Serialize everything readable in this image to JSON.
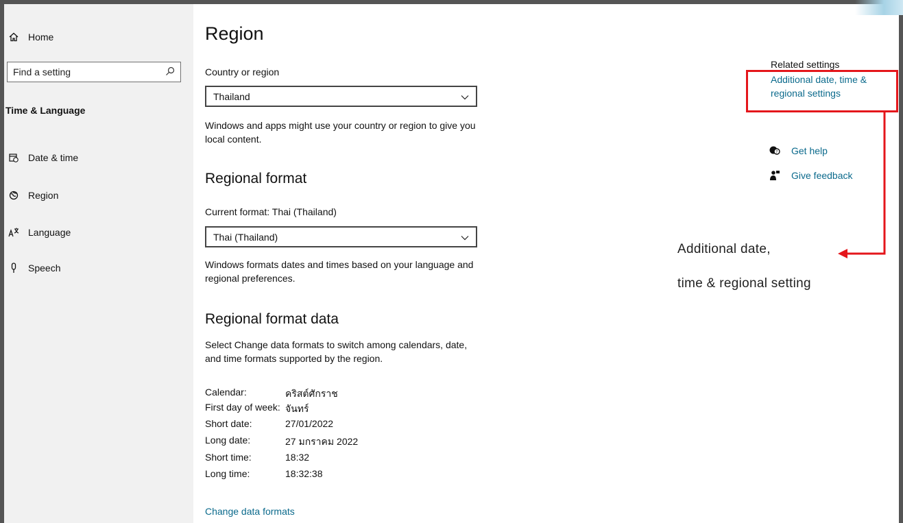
{
  "sidebar": {
    "home_label": "Home",
    "search_placeholder": "Find a setting",
    "section_title": "Time & Language",
    "items": [
      {
        "label": "Date & time",
        "icon": "calendar-clock-icon"
      },
      {
        "label": "Region",
        "icon": "globe-icon"
      },
      {
        "label": "Language",
        "icon": "language-icon"
      },
      {
        "label": "Speech",
        "icon": "microphone-icon"
      }
    ]
  },
  "main": {
    "title": "Region",
    "country_label": "Country or region",
    "country_value": "Thailand",
    "country_desc": "Windows and apps might use your country or region to give you local content.",
    "regional_format_heading": "Regional format",
    "current_format_label": "Current format: Thai (Thailand)",
    "format_value": "Thai (Thailand)",
    "format_desc": "Windows formats dates and times based on your language and regional preferences.",
    "format_data_heading": "Regional format data",
    "format_data_desc": "Select Change data formats to switch among calendars, date, and time formats supported by the region.",
    "data": [
      {
        "key": "Calendar:",
        "value": "คริสต์ศักราช"
      },
      {
        "key": "First day of week:",
        "value": "จันทร์"
      },
      {
        "key": "Short date:",
        "value": "27/01/2022"
      },
      {
        "key": "Long date:",
        "value": "27 มกราคม 2022"
      },
      {
        "key": "Short time:",
        "value": "18:32"
      },
      {
        "key": "Long time:",
        "value": "18:32:38"
      }
    ],
    "change_link": "Change data formats"
  },
  "related": {
    "title": "Related settings",
    "link": "Additional date, time & regional settings",
    "get_help": "Get help",
    "give_feedback": "Give feedback"
  },
  "annotation": {
    "line1": "Additional date,",
    "line2": "time & regional setting"
  },
  "colors": {
    "accent_link": "#0b6a8c",
    "highlight_red": "#e4161b",
    "sidebar_bg": "#f1f1f1"
  }
}
